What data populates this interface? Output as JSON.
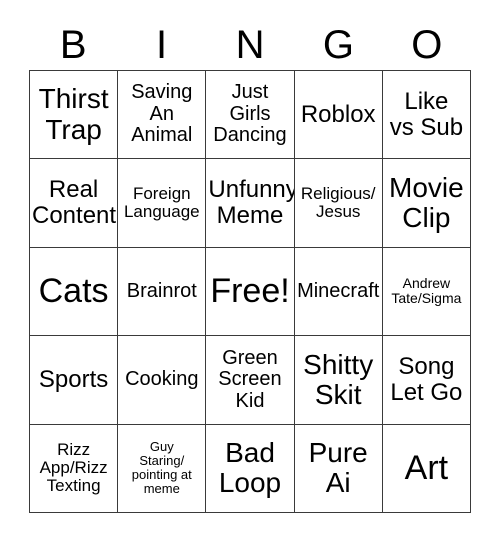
{
  "card": {
    "title": "BINGO",
    "columns": [
      "B",
      "I",
      "N",
      "G",
      "O"
    ],
    "free_space_label": "Free!",
    "colors": {
      "background": "#ffffff",
      "text": "#000000",
      "grid_line": "#3a3a3a"
    },
    "rows": [
      [
        {
          "label": "Thirst\nTrap",
          "size": "xl"
        },
        {
          "label": "Saving\nAn\nAnimal",
          "size": "md"
        },
        {
          "label": "Just\nGirls\nDancing",
          "size": "md"
        },
        {
          "label": "Roblox",
          "size": "lg"
        },
        {
          "label": "Like\nvs Sub",
          "size": "lg"
        }
      ],
      [
        {
          "label": "Real\nContent",
          "size": "lg"
        },
        {
          "label": "Foreign\nLanguage",
          "size": "sm"
        },
        {
          "label": "Unfunny\nMeme",
          "size": "lg"
        },
        {
          "label": "Religious/\nJesus",
          "size": "sm"
        },
        {
          "label": "Movie\nClip",
          "size": "xl"
        }
      ],
      [
        {
          "label": "Cats",
          "size": "xxl"
        },
        {
          "label": "Brainrot",
          "size": "md"
        },
        {
          "label": "Free!",
          "size": "xxl"
        },
        {
          "label": "Minecraft",
          "size": "md"
        },
        {
          "label": "Andrew\nTate/Sigma",
          "size": "xs"
        }
      ],
      [
        {
          "label": "Sports",
          "size": "lg"
        },
        {
          "label": "Cooking",
          "size": "md"
        },
        {
          "label": "Green\nScreen\nKid",
          "size": "md"
        },
        {
          "label": "Shitty\nSkit",
          "size": "xl"
        },
        {
          "label": "Song\nLet Go",
          "size": "lg"
        }
      ],
      [
        {
          "label": "Rizz\nApp/Rizz\nTexting",
          "size": "sm"
        },
        {
          "label": "Guy\nStaring/\npointing at\nmeme",
          "size": "xxs"
        },
        {
          "label": "Bad\nLoop",
          "size": "xl"
        },
        {
          "label": "Pure\nAi",
          "size": "xl"
        },
        {
          "label": "Art",
          "size": "xxl"
        }
      ]
    ]
  }
}
